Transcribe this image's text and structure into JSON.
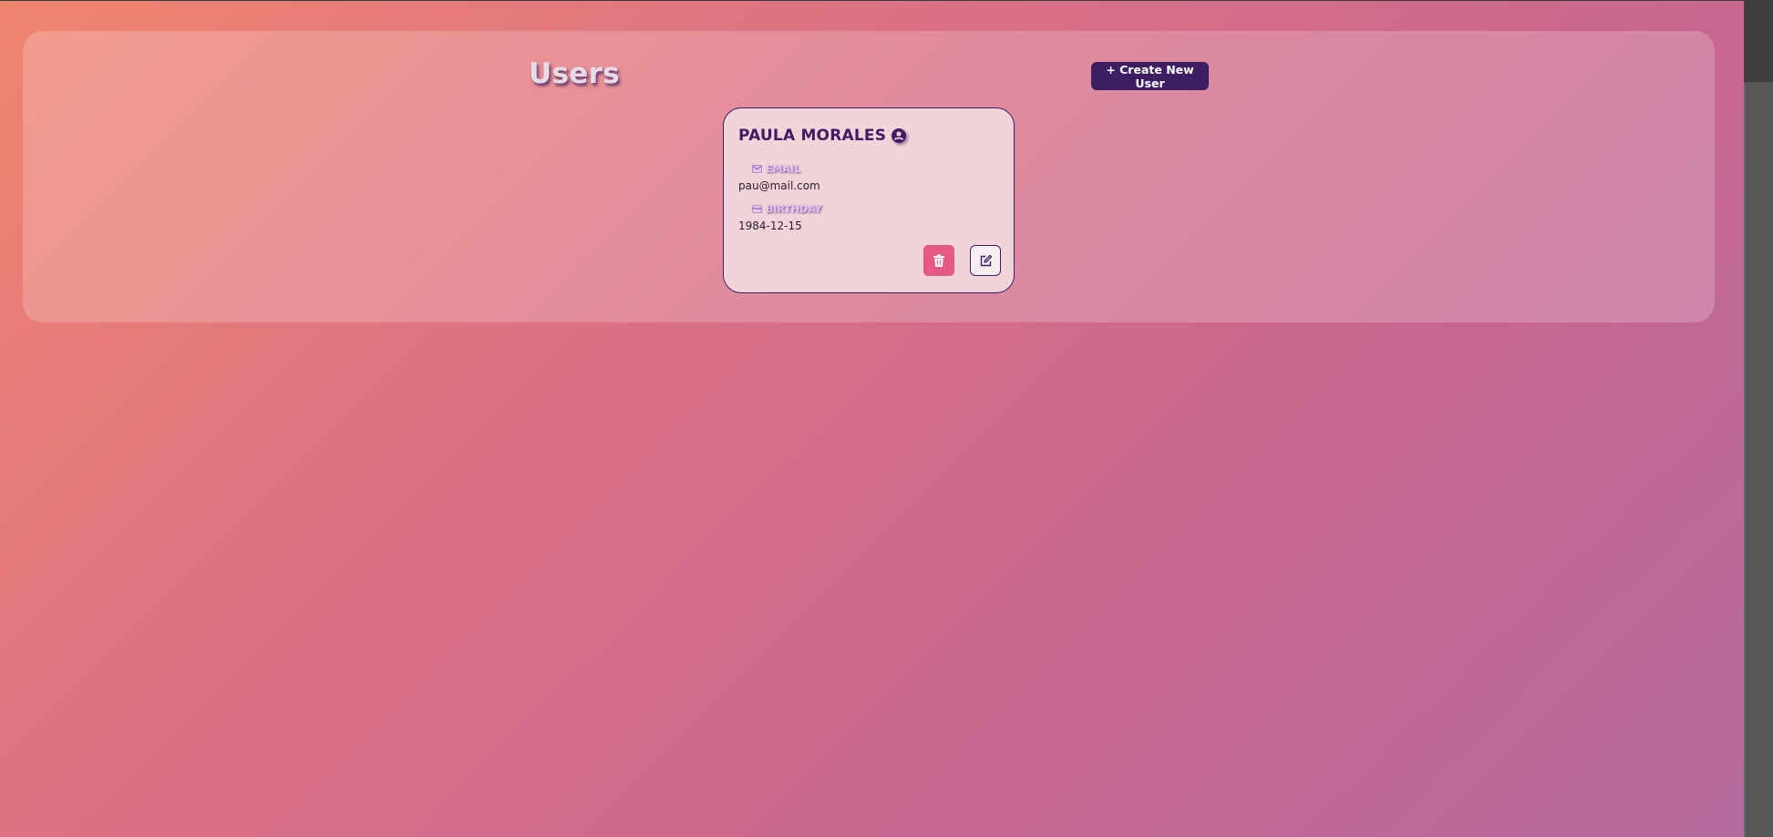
{
  "header": {
    "title": "Users",
    "create_label": "+ Create New User"
  },
  "users": [
    {
      "name": "PAULA MORALES",
      "email_label": "EMAIL",
      "email": "pau@mail.com",
      "birthday_label": "BIRTHDAY",
      "birthday": "1984-12-15"
    }
  ],
  "colors": {
    "accent": "#3d1e63",
    "delete": "#e45a83",
    "card_bg": "#f3d3da"
  },
  "icons": {
    "user": "user-circle-icon",
    "email": "envelope-icon",
    "birthday": "calendar-icon",
    "delete": "trash-icon",
    "edit": "edit-icon"
  }
}
